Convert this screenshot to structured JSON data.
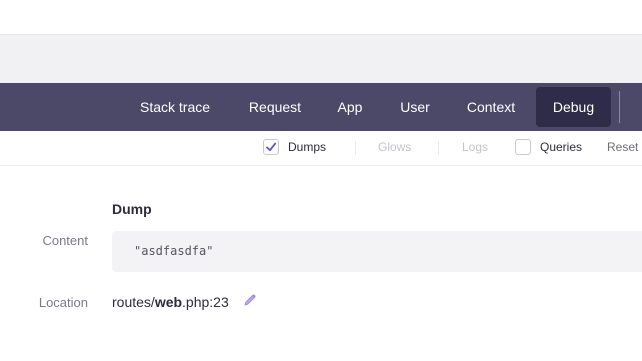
{
  "tabs": [
    {
      "label": "Stack trace",
      "active": false
    },
    {
      "label": "Request",
      "active": false
    },
    {
      "label": "App",
      "active": false
    },
    {
      "label": "User",
      "active": false
    },
    {
      "label": "Context",
      "active": false
    },
    {
      "label": "Debug",
      "active": true
    }
  ],
  "filters": {
    "dumps": {
      "label": "Dumps",
      "checked": true
    },
    "glows": {
      "label": "Glows",
      "enabled": false
    },
    "logs": {
      "label": "Logs",
      "enabled": false
    },
    "queries": {
      "label": "Queries",
      "checked": false
    },
    "reset_label": "Reset"
  },
  "dump": {
    "title": "Dump",
    "content_label": "Content",
    "content_value": "\"asdfasdfa\"",
    "location_label": "Location",
    "location_prefix": "routes/",
    "location_file": "web",
    "location_suffix": ".php:23",
    "edit_icon": "pencil-icon"
  },
  "colors": {
    "tabbar": "#4b4868",
    "active_tab": "#2f2c4a",
    "accent": "#6b4bd4"
  }
}
